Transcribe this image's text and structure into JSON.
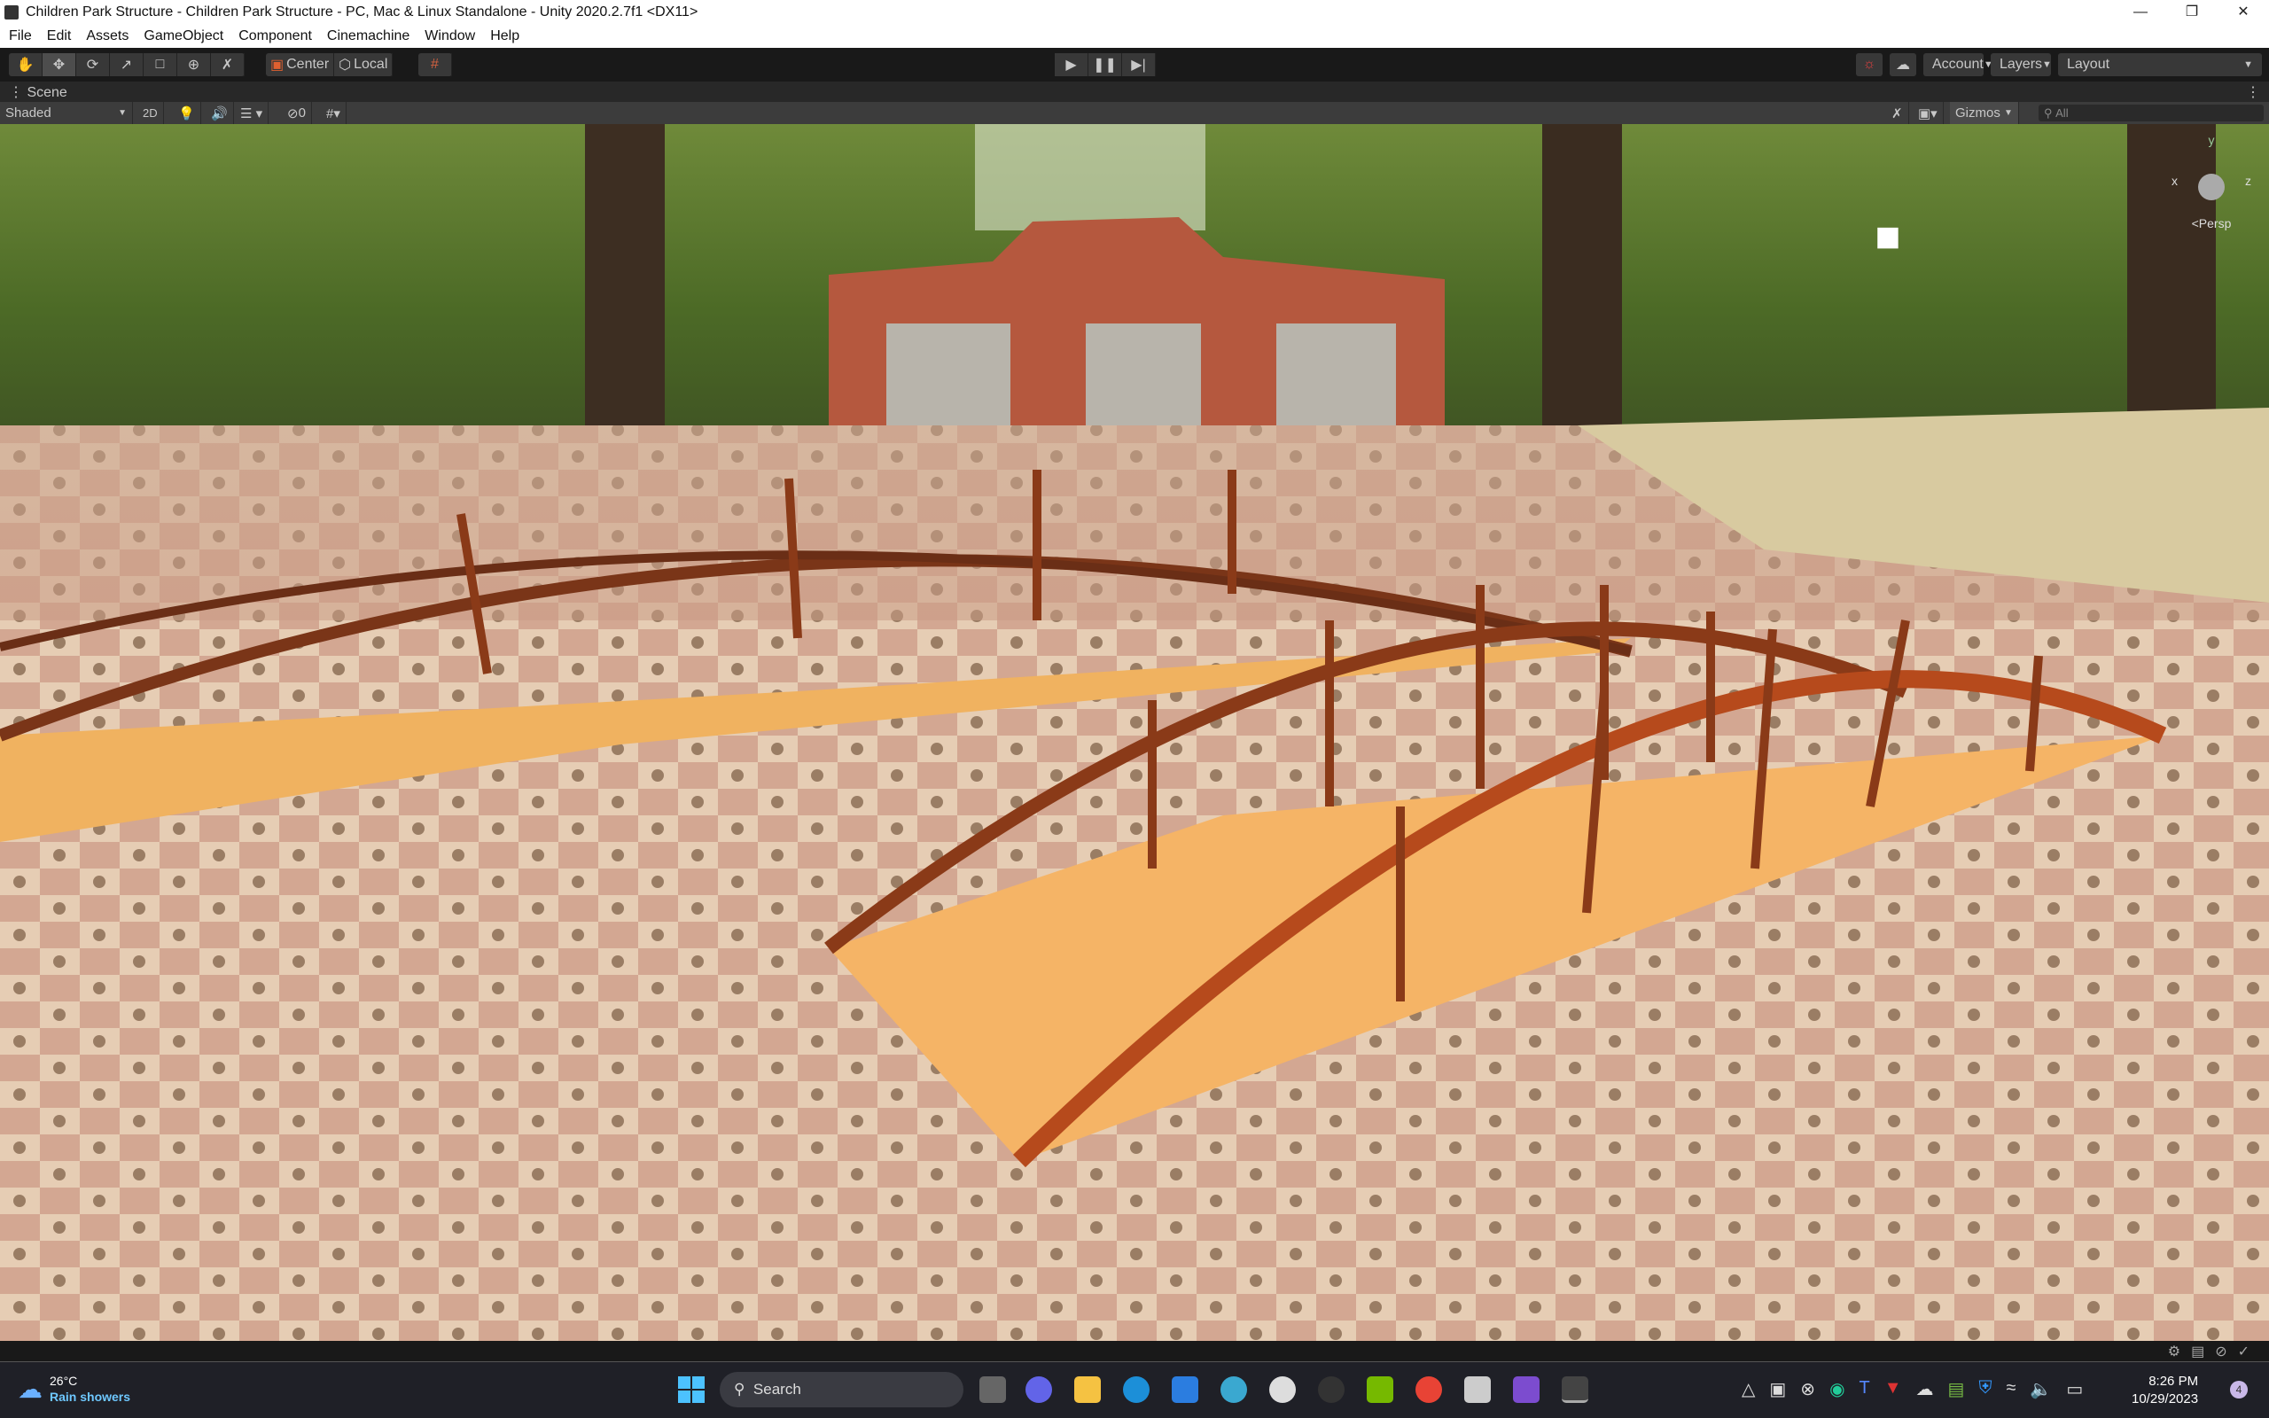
{
  "window": {
    "title": "Children Park Structure - Children Park Structure - PC, Mac & Linux Standalone - Unity 2020.2.7f1 <DX11>",
    "controls": [
      "minimize-icon",
      "maximize-icon",
      "close-icon"
    ]
  },
  "menu": [
    "File",
    "Edit",
    "Assets",
    "GameObject",
    "Component",
    "Cinemachine",
    "Window",
    "Help"
  ],
  "toolbar": {
    "tools": [
      "hand-icon",
      "move-icon",
      "rotate-icon",
      "scale-icon",
      "rect-icon",
      "transform-icon",
      "custom-tool-icon"
    ],
    "pivot_mode": "Center",
    "pivot_rotation": "Local",
    "account": "Account",
    "layers": "Layers",
    "layout": "Layout"
  },
  "scene_tab": {
    "label": "Scene"
  },
  "scene_toolbar": {
    "draw_mode": "Shaded",
    "mode_2d": "2D",
    "hidden_count": "0",
    "gizmos": "Gizmos",
    "search_placeholder": "All"
  },
  "gizmo": {
    "y": "y",
    "x": "x",
    "z": "z",
    "projection": "<Persp"
  },
  "taskbar": {
    "weather_temp": "26°C",
    "weather_desc": "Rain showers",
    "search": "Search",
    "time": "8:26 PM",
    "date": "10/29/2023",
    "notifications": "4"
  },
  "colors": {
    "accent": "#4cc2ff",
    "editor_bg": "#191919"
  }
}
